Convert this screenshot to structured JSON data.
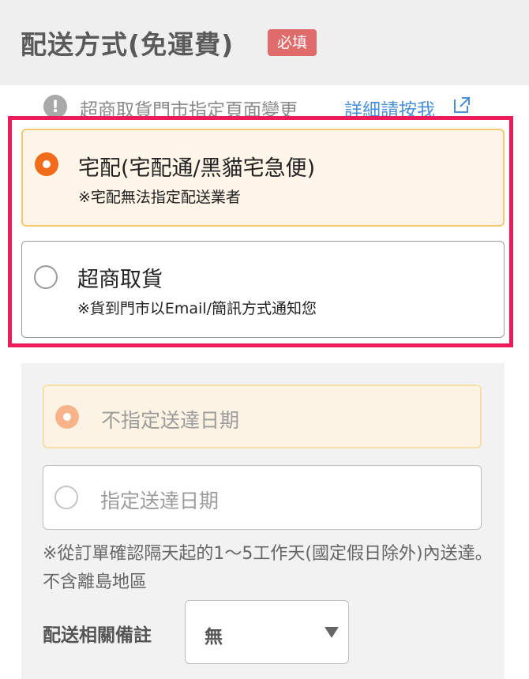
{
  "header": {
    "title": "配送方式(免運費)",
    "required_badge": "必填"
  },
  "notice": {
    "icon": "exclamation-circle-icon",
    "text": "超商取貨門市指定頁面變更",
    "link_text": "詳細請按我",
    "link_icon": "external-link-icon"
  },
  "shipping_options": [
    {
      "label": "宅配(宅配通/黑貓宅急便)",
      "note": "※宅配無法指定配送業者",
      "selected": true
    },
    {
      "label": "超商取貨",
      "note": "※貨到門市以Email/簡訊方式通知您",
      "selected": false
    }
  ],
  "delivery_date": {
    "options": [
      {
        "label": "不指定送達日期",
        "selected": true
      },
      {
        "label": "指定送達日期",
        "selected": false
      }
    ],
    "note": "※從訂單確認隔天起的1～5工作天(國定假日除外)內送達。不含離島地區"
  },
  "remarks": {
    "label": "配送相關備註",
    "selected_value": "無"
  },
  "colors": {
    "accent_orange": "#f26a1b",
    "highlight_frame": "#ec1c5a",
    "badge_red": "#e06b6b",
    "link_blue": "#4a90d9"
  }
}
